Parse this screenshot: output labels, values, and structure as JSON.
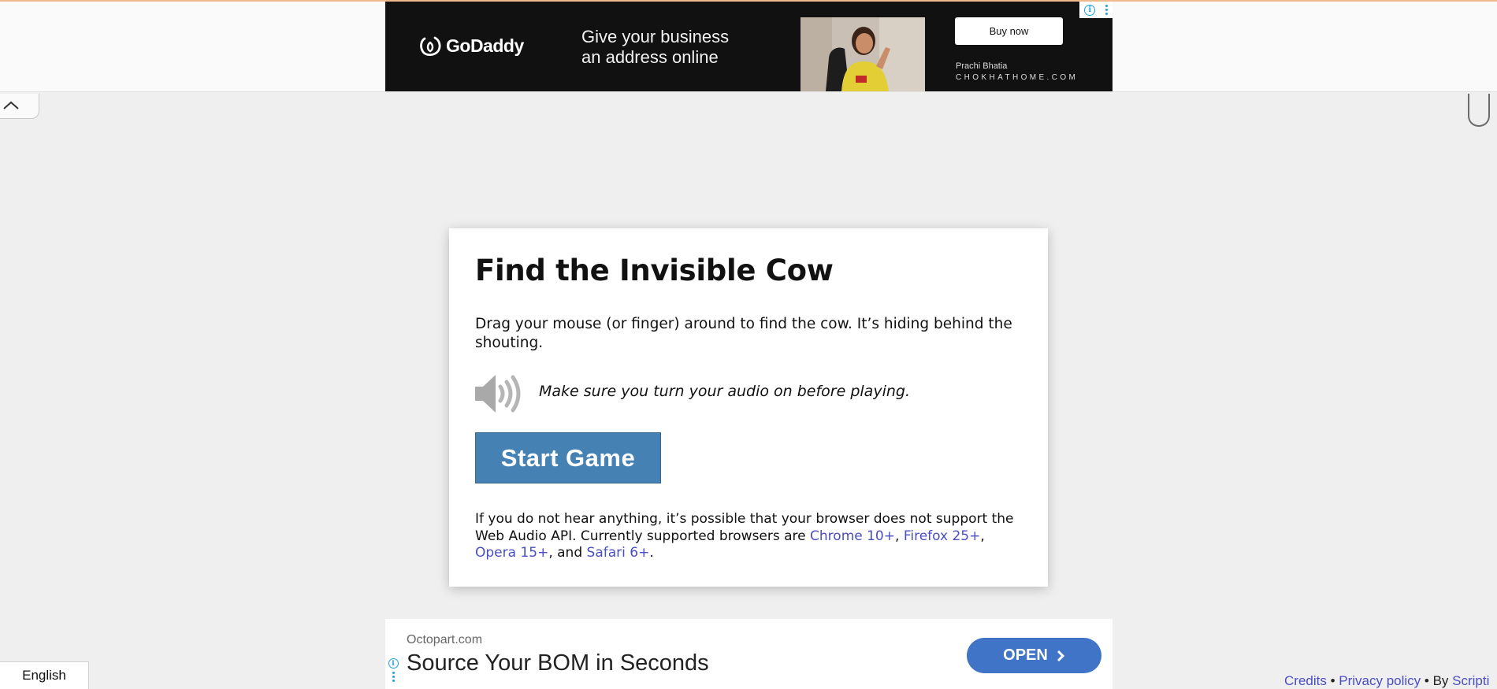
{
  "top_ad": {
    "brand": "GoDaddy",
    "headline_line1": "Give your business",
    "headline_line2": "an address online",
    "cta_label": "Buy now",
    "person_name": "Prachi Bhatia",
    "site": "CHOKHATHOME.COM",
    "background_color": "#111111"
  },
  "game": {
    "title": "Find the Invisible Cow",
    "description": "Drag your mouse (or finger) around to find the cow. It’s hiding behind the shouting.",
    "audio_note": "Make sure you turn your audio on before playing.",
    "start_button": "Start Game",
    "button_color": "#4681b4",
    "support_text_before": "If you do not hear anything, it’s possible that your browser does not support the Web Audio API. Currently supported browsers are ",
    "browsers": [
      "Chrome 10+",
      "Firefox 25+",
      "Opera 15+",
      "Safari 6+"
    ],
    "sep_comma": ", ",
    "sep_and": ", and ",
    "support_text_end": "."
  },
  "bottom_ad": {
    "domain": "Octopart.com",
    "headline": "Source Your BOM in Seconds",
    "cta_label": "OPEN",
    "cta_color": "#3f74c6"
  },
  "footer": {
    "language": "English",
    "credits": "Credits",
    "bullet": " • ",
    "privacy": "Privacy policy",
    "by": "By ",
    "author_partial": "Scripti"
  },
  "icons": {
    "collapse": "chevron-up-icon",
    "speaker": "speaker-icon",
    "adchoices": "info-icon",
    "menu": "kebab-menu-icon",
    "open_arrow": "chevron-right-icon"
  }
}
